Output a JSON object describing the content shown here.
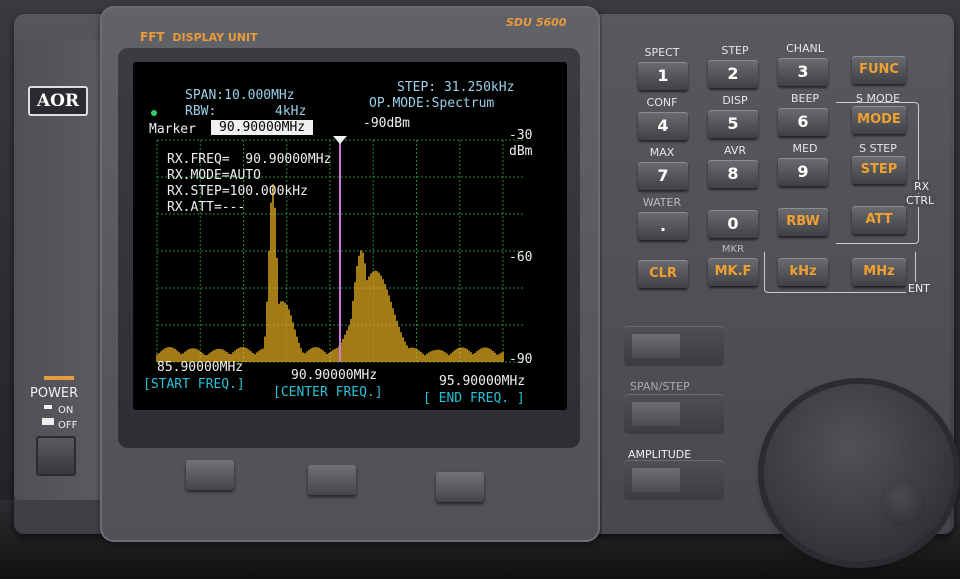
{
  "brand": {
    "logo": "AOR",
    "model": "SDU 5600",
    "unit_title_fft": "FFT",
    "unit_title": "DISPLAY UNIT"
  },
  "power": {
    "label": "POWER",
    "on": "ON",
    "off": "OFF"
  },
  "screen": {
    "span": "SPAN:10.000MHz",
    "step": "STEP: 31.250kHz",
    "rbw_label": "RBW:",
    "rbw_value": "4kHz",
    "op_mode": "OP.MODE:Spectrum",
    "marker_label": "Marker",
    "marker_freq": "90.90000MHz",
    "marker_level": "-90dBm",
    "rx_freq": "RX.FREQ=  90.90000MHz",
    "rx_mode": "RX.MODE=AUTO",
    "rx_step": "RX.STEP=100.000kHz",
    "rx_att": "RX.ATT=---",
    "scale_top": "-30",
    "scale_unit": "dBm",
    "scale_mid": "-60",
    "scale_bot": "-90",
    "start_freq": "85.90000MHz",
    "center_freq": "90.90000MHz",
    "end_freq": "95.90000MHz",
    "start_label": "[START FREQ.]",
    "center_label": "[CENTER FREQ.]",
    "end_label": "[ END FREQ. ]",
    "trace_color": "#e8b020"
  },
  "keypad": {
    "row1_labels": [
      "SPECT",
      "STEP",
      "CHANL",
      "S MODE"
    ],
    "row1_keys": [
      "1",
      "2",
      "3",
      "FUNC"
    ],
    "row2_labels": [
      "CONF",
      "DISP",
      "BEEP",
      "S STEP"
    ],
    "row2_keys": [
      "4",
      "5",
      "6",
      "MODE"
    ],
    "row3_labels": [
      "MAX",
      "AVR",
      "MED"
    ],
    "row3_keys": [
      "7",
      "8",
      "9",
      "STEP"
    ],
    "row4_labels": [
      "WATER",
      "",
      ""
    ],
    "row4_keys": [
      ".",
      "0",
      "RBW",
      "ATT"
    ],
    "row5_labels": [
      "",
      "MKR",
      ""
    ],
    "row5_keys": [
      "CLR",
      "MK.F",
      "kHz",
      "MHz"
    ],
    "rx_label": "RX",
    "ctrl_label": "CTRL",
    "ent_label": "ENT",
    "span_step": "SPAN/STEP",
    "amplitude": "AMPLITUDE"
  }
}
